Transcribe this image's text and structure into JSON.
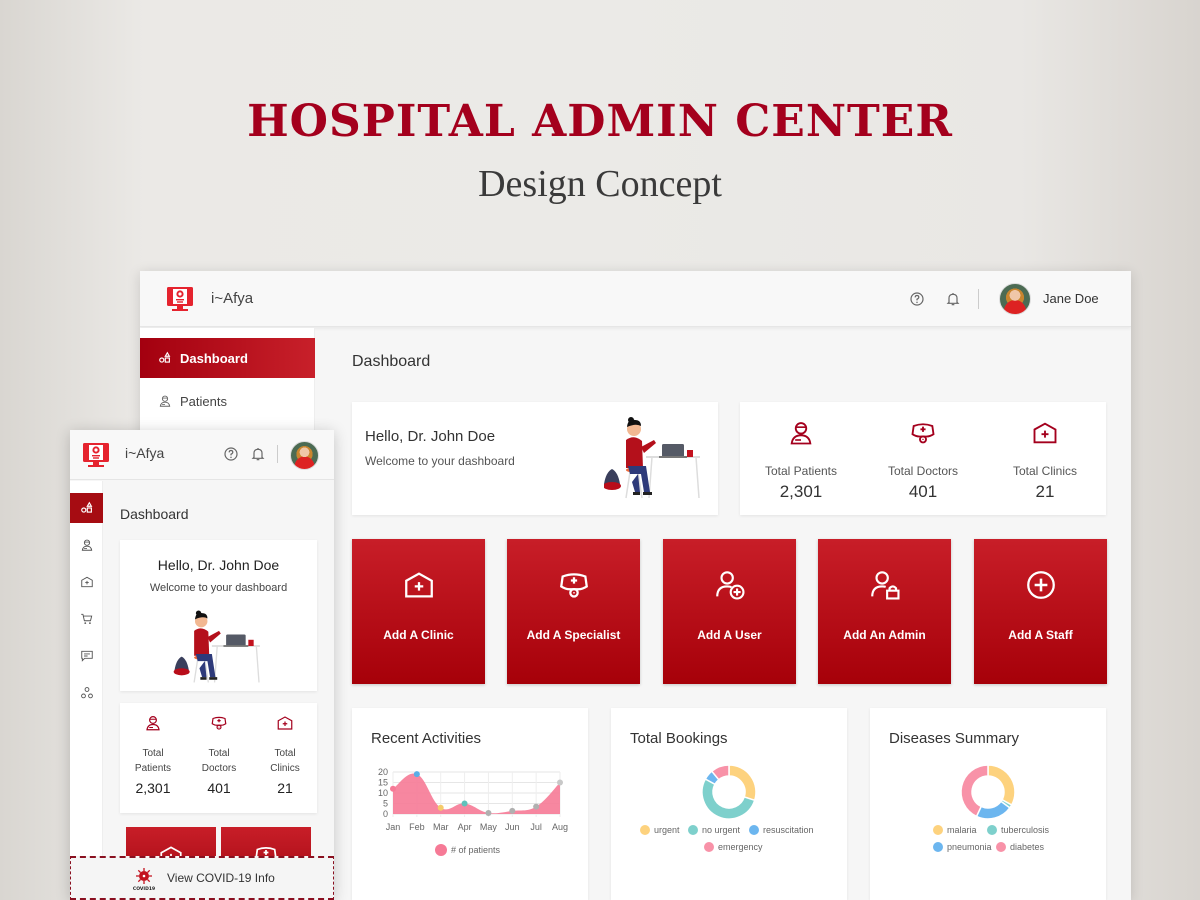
{
  "hero": {
    "title": "HOSPITAL ADMIN CENTER",
    "subtitle": "Design Concept"
  },
  "app": {
    "brand": "i~Afya",
    "user_name": "Jane Doe",
    "accent_color": "#a4001d",
    "icons": {
      "help": "help-circle-icon",
      "notifications": "bell-icon",
      "logo": "monitor-medical-icon"
    }
  },
  "desktop": {
    "sidebar": {
      "items": [
        {
          "label": "Dashboard",
          "icon": "shapes-icon",
          "active": true
        },
        {
          "label": "Patients",
          "icon": "patient-icon",
          "active": false
        }
      ]
    },
    "page_title": "Dashboard",
    "welcome": {
      "hello": "Hello, Dr. John Doe",
      "subtitle": "Welcome to your dashboard"
    },
    "stats": [
      {
        "label": "Total Patients",
        "value": "2,301",
        "icon": "patient-icon"
      },
      {
        "label": "Total Doctors",
        "value": "401",
        "icon": "doctor-cap-icon"
      },
      {
        "label": "Total Clinics",
        "value": "21",
        "icon": "clinic-icon"
      }
    ],
    "actions": [
      {
        "label": "Add A Clinic",
        "icon": "clinic-icon"
      },
      {
        "label": "Add A Specialist",
        "icon": "doctor-cap-icon"
      },
      {
        "label": "Add A User",
        "icon": "user-add-icon"
      },
      {
        "label": "Add An Admin",
        "icon": "user-lock-icon"
      },
      {
        "label": "Add A Staff",
        "icon": "plus-circle-icon"
      }
    ],
    "panels": {
      "recent_activities": {
        "title": "Recent Activities"
      },
      "total_bookings": {
        "title": "Total Bookings"
      },
      "diseases_summary": {
        "title": "Diseases Summary"
      }
    }
  },
  "mobile": {
    "brand": "i~Afya",
    "rail": [
      {
        "icon": "shapes-icon",
        "active": true
      },
      {
        "icon": "patient-icon",
        "active": false
      },
      {
        "icon": "clinic-icon",
        "active": false
      },
      {
        "icon": "cart-icon",
        "active": false
      },
      {
        "icon": "message-icon",
        "active": false
      },
      {
        "icon": "network-icon",
        "active": false
      }
    ],
    "page_title": "Dashboard",
    "welcome": {
      "hello": "Hello, Dr. John Doe",
      "subtitle": "Welcome to your dashboard"
    },
    "stats": [
      {
        "label_line1": "Total",
        "label_line2": "Patients",
        "value": "2,301"
      },
      {
        "label_line1": "Total",
        "label_line2": "Doctors",
        "value": "401"
      },
      {
        "label_line1": "Total",
        "label_line2": "Clinics",
        "value": "21"
      }
    ],
    "covid": {
      "label": "View COVID-19 Info",
      "badge": "COVID19"
    }
  },
  "chart_data": [
    {
      "type": "area",
      "title": "Recent Activities",
      "categories": [
        "Jan",
        "Feb",
        "Mar",
        "Apr",
        "May",
        "Jun",
        "Jul",
        "Aug"
      ],
      "series": [
        {
          "name": "# of patients",
          "values": [
            12,
            19,
            3,
            5,
            0.5,
            1.5,
            3.5,
            15
          ],
          "color": "#f67a96"
        }
      ],
      "point_colors": [
        "#f67a96",
        "#5aaee6",
        "#f5cb6b",
        "#5fc2bb",
        "#b0b0b0",
        "#b0b0b0",
        "#b0b0b0",
        "#c8c8c8"
      ],
      "ylim": [
        0,
        20
      ],
      "yticks": [
        0,
        5,
        10,
        15,
        20
      ],
      "grid": true,
      "legend": "bottom"
    },
    {
      "type": "pie",
      "title": "Total Bookings",
      "donut": true,
      "labels": [
        "urgent",
        "no urgent",
        "resuscitation",
        "emergency"
      ],
      "values": [
        30,
        53,
        6,
        11
      ],
      "colors": [
        "#fdd27e",
        "#7ed0cc",
        "#6cb6ef",
        "#f892a8"
      ],
      "legend": "bottom"
    },
    {
      "type": "pie",
      "title": "Diseases Summary",
      "donut": true,
      "labels": [
        "malaria",
        "tuberculosis",
        "pneumonia",
        "diabetes"
      ],
      "values": [
        33,
        2,
        22,
        43
      ],
      "colors": [
        "#fdd27e",
        "#7ed0cc",
        "#6cb6ef",
        "#f892a8"
      ],
      "legend": "bottom"
    }
  ]
}
